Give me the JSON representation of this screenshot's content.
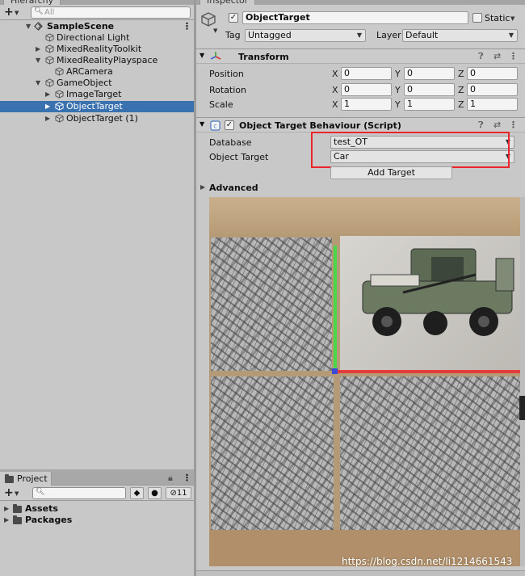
{
  "hierarchy": {
    "tab_label": "Hierarchy",
    "search_placeholder": "All",
    "scene": "SampleScene",
    "items": [
      {
        "label": "Directional Light"
      },
      {
        "label": "MixedRealityToolkit"
      },
      {
        "label": "MixedRealityPlayspace"
      },
      {
        "label": "ARCamera"
      },
      {
        "label": "GameObject"
      },
      {
        "label": "ImageTarget"
      },
      {
        "label": "ObjectTarget"
      },
      {
        "label": "ObjectTarget (1)"
      }
    ]
  },
  "project": {
    "tab_label": "Project",
    "hidden_count": "11",
    "folders": [
      {
        "label": "Assets"
      },
      {
        "label": "Packages"
      }
    ]
  },
  "inspector": {
    "tab_label": "Inspector",
    "object_name": "ObjectTarget",
    "active_checked": true,
    "static_label": "Static",
    "tag_label": "Tag",
    "tag_value": "Untagged",
    "layer_label": "Layer",
    "layer_value": "Default",
    "transform": {
      "title": "Transform",
      "rows": [
        {
          "label": "Position",
          "x": "0",
          "y": "0",
          "z": "0"
        },
        {
          "label": "Rotation",
          "x": "0",
          "y": "0",
          "z": "0"
        },
        {
          "label": "Scale",
          "x": "1",
          "y": "1",
          "z": "1"
        }
      ]
    },
    "behaviour": {
      "title": "Object Target Behaviour (Script)",
      "database_label": "Database",
      "database_value": "test_OT",
      "object_target_label": "Object Target",
      "object_target_value": "Car",
      "add_target_label": "Add Target",
      "advanced_label": "Advanced"
    }
  },
  "watermark": "https://blog.csdn.net/li1214661543",
  "colors": {
    "selection": "#3a72b0",
    "highlight_box": "#e8262b",
    "axis_y": "#48d84a",
    "axis_x": "#e33c3c"
  }
}
